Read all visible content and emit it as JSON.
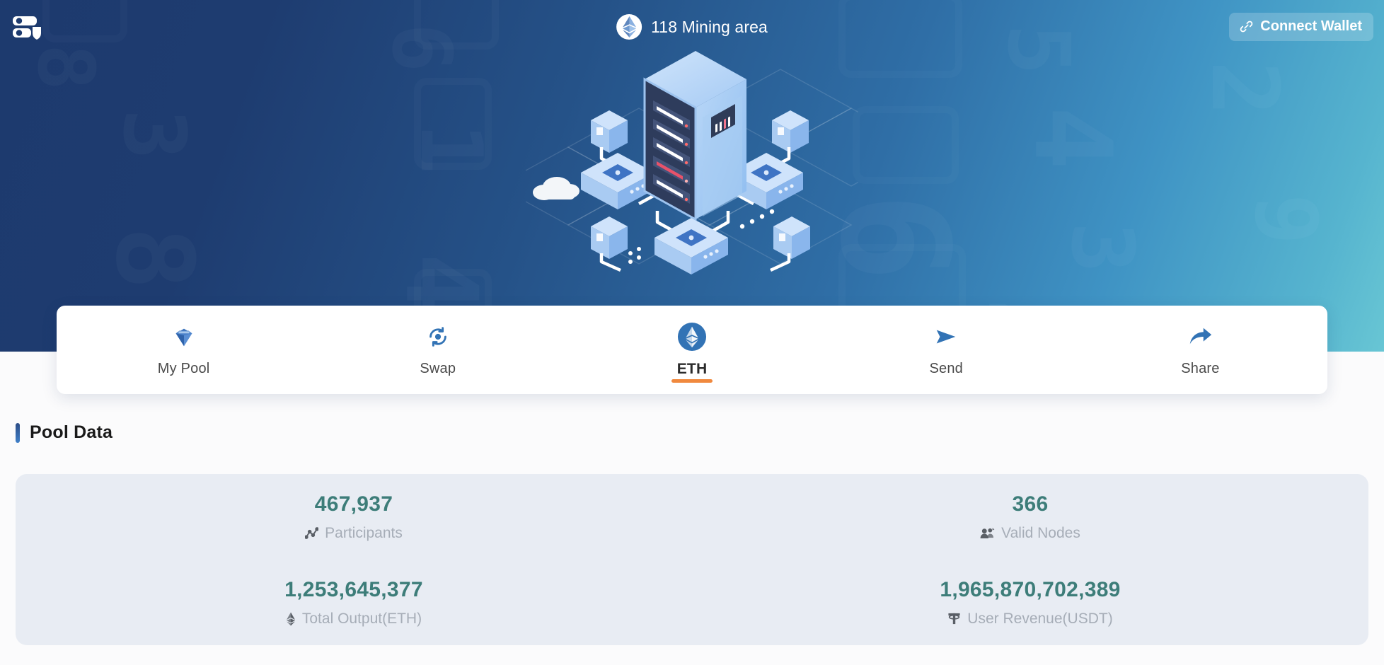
{
  "header": {
    "logo_alt": "server-shield-logo",
    "title": "118 Mining area",
    "connect_wallet_label": "Connect Wallet"
  },
  "tabs": [
    {
      "label": "My Pool",
      "icon": "diamond-icon",
      "active": false
    },
    {
      "label": "Swap",
      "icon": "swap-circular-arrows-icon",
      "active": false
    },
    {
      "label": "ETH",
      "icon": "ethereum-icon",
      "active": true
    },
    {
      "label": "Send",
      "icon": "send-arrow-icon",
      "active": false
    },
    {
      "label": "Share",
      "icon": "share-arrow-icon",
      "active": false
    }
  ],
  "pool_data": {
    "section_title": "Pool Data",
    "stats": [
      {
        "value": "467,937",
        "label": "Participants",
        "icon": "chart-line-icon"
      },
      {
        "value": "366",
        "label": "Valid Nodes",
        "icon": "people-group-icon"
      },
      {
        "value": "1,253,645,377",
        "label": "Total Output(ETH)",
        "icon": "ethereum-diamond-icon"
      },
      {
        "value": "1,965,870,702,389",
        "label": "User Revenue(USDT)",
        "icon": "tether-icon"
      }
    ]
  },
  "colors": {
    "hero_dark": "#1d3a6e",
    "hero_light": "#68c6d4",
    "accent_orange": "#f0893e",
    "stat_value": "#3d7d79",
    "panel_bg": "#e8ecf3",
    "tab_blue": "#3273b5"
  },
  "background_digits": [
    "8",
    "3",
    "6",
    "1",
    "4",
    "2",
    "6",
    "4",
    "3",
    "8",
    "9"
  ]
}
